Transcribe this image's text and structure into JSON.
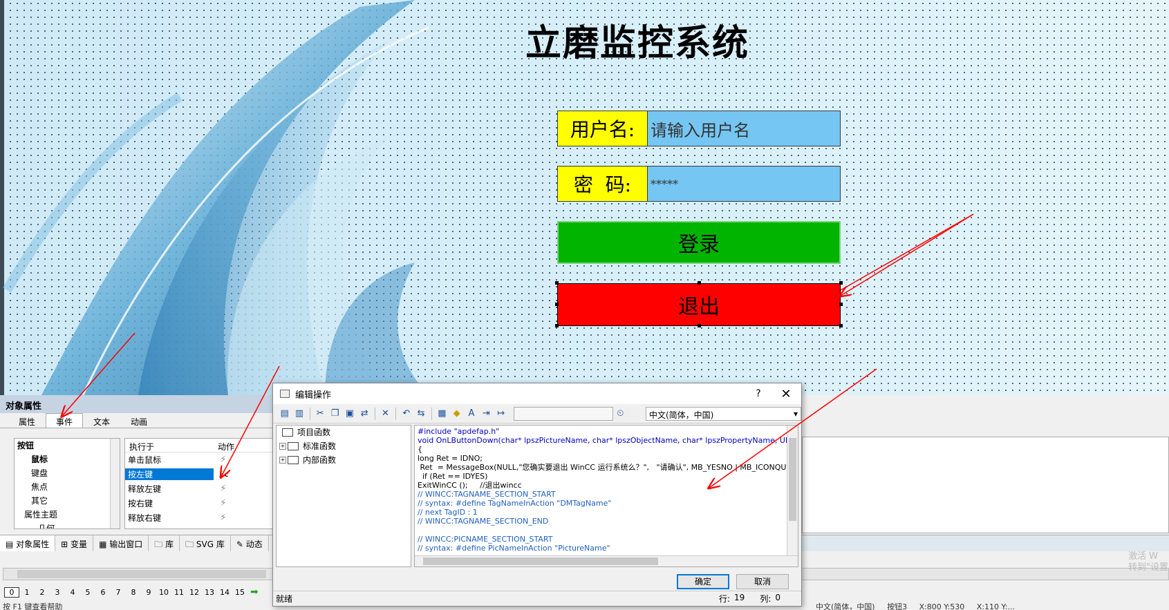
{
  "canvas": {
    "title": "立磨监控系统",
    "user_label": "用户名:",
    "user_placeholder": "请输入用户名",
    "pass_label": "密  码:",
    "pass_value": "*****",
    "login_label": "登录",
    "exit_label": "退出",
    "colors": {
      "label_bg": "#ffff00",
      "input_bg": "#76c6f3",
      "login_bg": "#00b400",
      "exit_bg": "#ff0000"
    }
  },
  "obj_panel": {
    "header": "对象属性",
    "tabs": [
      "属性",
      "事件",
      "文本",
      "动画"
    ],
    "active_tab": "事件",
    "tree": [
      "按钮",
      "鼠标",
      "键盘",
      "焦点",
      "其它",
      "属性主题",
      "几何"
    ],
    "event_headers": [
      "执行于",
      "动作"
    ],
    "events": [
      {
        "name": "单击鼠标",
        "active": false
      },
      {
        "name": "按左键",
        "active": true,
        "suffix": "c"
      },
      {
        "name": "释放左键",
        "active": false
      },
      {
        "name": "按右键",
        "active": false
      },
      {
        "name": "释放右键",
        "active": false
      }
    ]
  },
  "bottom_tabs": [
    "对象属性",
    "变量",
    "输出窗口",
    "库",
    "SVG 库",
    "动态"
  ],
  "pages": [
    "0",
    "1",
    "2",
    "3",
    "4",
    "5",
    "6",
    "7",
    "8",
    "9",
    "10",
    "11",
    "12",
    "13",
    "14",
    "15"
  ],
  "status": {
    "help": "按 F1 键查看帮助",
    "lang": "中文(简体，中国)",
    "object": "按钮3",
    "coords1": "X:800 Y:530",
    "coords2": "X:110 Y:..."
  },
  "watermark": {
    "line1": "激活 W",
    "line2": "转到\"设置"
  },
  "dialog": {
    "title": "编辑操作",
    "help": "?",
    "close": "✕",
    "language": "中文(简体，中国)",
    "tree": [
      {
        "label": "项目函数",
        "expand": ""
      },
      {
        "label": "标准函数",
        "expand": "+"
      },
      {
        "label": "内部函数",
        "expand": "+"
      }
    ],
    "code": [
      {
        "text": "#include \"apdefap.h\"",
        "cls": "cl-inc"
      },
      {
        "text": "void OnLButtonDown(char* lpszPictureName, char* lpszObjectName, char* lpszPropertyName, UINT nFlags, int x,",
        "cls": "cl-inc"
      },
      {
        "text": "{",
        "cls": "cl-dark"
      },
      {
        "text": "long Ret = IDNO;",
        "cls": "cl-dark"
      },
      {
        "text": " Ret  = MessageBox(NULL,\"您确实要退出 WinCC 运行系统么？\",   \"请确认\", MB_YESNO | MB_ICONQUESTI",
        "cls": "cl-dark"
      },
      {
        "text": "  if (Ret == IDYES)",
        "cls": "cl-dark"
      },
      {
        "text": "ExitWinCC ();     //退出wincc",
        "cls": "cl-dark"
      },
      {
        "text": "// WINCC:TAGNAME_SECTION_START",
        "cls": "cl-com"
      },
      {
        "text": "// syntax: #define TagNameInAction \"DMTagName\"",
        "cls": "cl-com"
      },
      {
        "text": "// next TagID : 1",
        "cls": "cl-com"
      },
      {
        "text": "// WINCC:TAGNAME_SECTION_END",
        "cls": "cl-com"
      },
      {
        "text": "",
        "cls": "cl-com"
      },
      {
        "text": "// WINCC:PICNAME_SECTION_START",
        "cls": "cl-com"
      },
      {
        "text": "// syntax: #define PicNameInAction \"PictureName\"",
        "cls": "cl-com"
      }
    ],
    "ok_label": "确定",
    "cancel_label": "取消",
    "status_text": "就绪",
    "line_label": "行:",
    "line_value": "19",
    "col_label": "列:",
    "col_value": "0"
  }
}
